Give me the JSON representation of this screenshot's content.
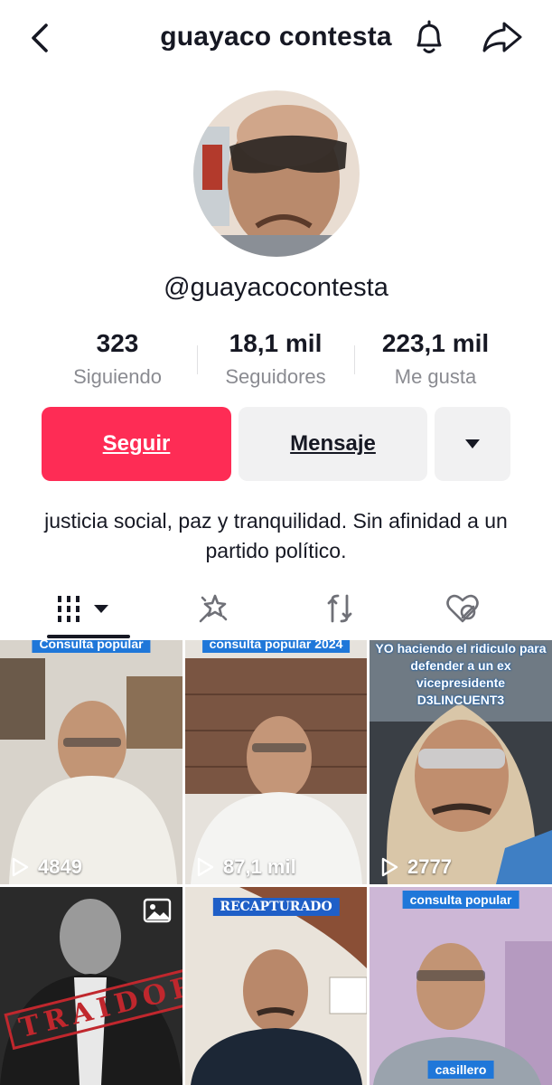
{
  "header": {
    "title": "guayaco contesta",
    "icons": {
      "back": "chevron-left-icon",
      "bell": "bell-icon",
      "share": "share-icon"
    }
  },
  "profile": {
    "handle": "@guayacocontesta",
    "stats": [
      {
        "value": "323",
        "label": "Siguiendo"
      },
      {
        "value": "18,1 mil",
        "label": "Seguidores"
      },
      {
        "value": "223,1 mil",
        "label": "Me gusta"
      }
    ],
    "follow_label": "Seguir",
    "message_label": "Mensaje",
    "bio": "justicia social, paz y tranquilidad. Sin afinidad a un partido político."
  },
  "tabs": [
    {
      "icon": "grid-icon",
      "active": true
    },
    {
      "icon": "magic-wand-icon",
      "active": false
    },
    {
      "icon": "repost-icon",
      "active": false
    },
    {
      "icon": "liked-hidden-icon",
      "active": false
    }
  ],
  "videos": [
    {
      "views": "4849",
      "banner": ""
    },
    {
      "views": "87,1 mil",
      "banner": "consulta popular 2024"
    },
    {
      "views": "2777",
      "caption": "YO haciendo el ridiculo para defender a un ex vicepresidente D3LINCUENT3"
    },
    {
      "views": "",
      "stamp": "TRAIDOR"
    },
    {
      "views": "",
      "banner": "RECAPTURADO"
    },
    {
      "views": "",
      "banner": "consulta popular",
      "bottom_label": "casillero"
    }
  ],
  "colors": {
    "accent": "#fe2c55",
    "secondary_button": "#f1f1f2",
    "muted_text": "#8a8b91",
    "banner_blue": "#1f77d9"
  }
}
